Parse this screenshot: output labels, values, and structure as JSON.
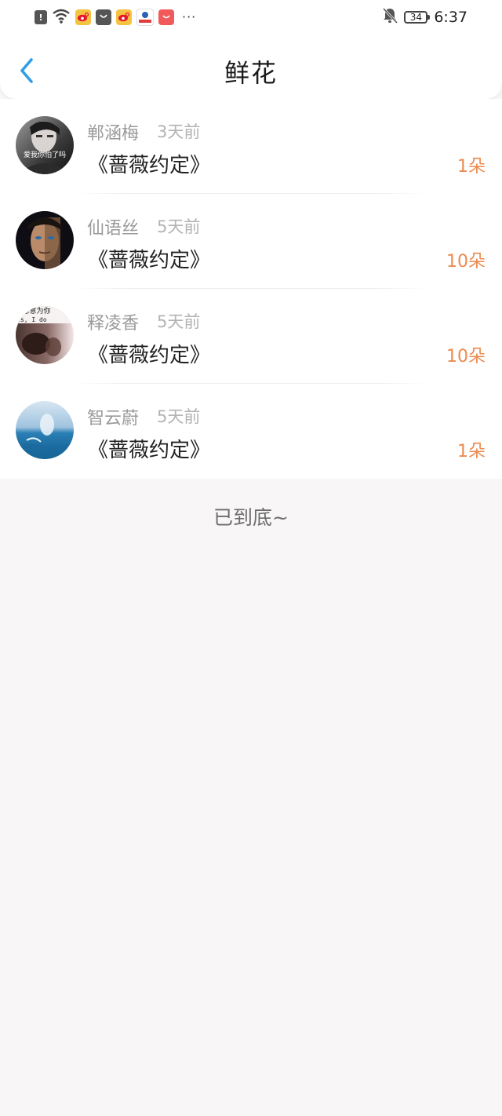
{
  "status_bar": {
    "battery": "34",
    "time": "6:37",
    "more": "···",
    "icons": [
      "alert-icon",
      "wifi-icon",
      "weibo-icon",
      "shopping-bag-icon",
      "weibo-icon",
      "app-icon",
      "app-icon"
    ]
  },
  "header": {
    "title": "鲜花",
    "back_icon": "chevron-left-icon"
  },
  "items": [
    {
      "name": "郸涵梅",
      "time": "3天前",
      "book": "《蔷薇约定》",
      "count": "1朵",
      "avatar_text": "爱我你怕了吗"
    },
    {
      "name": "仙语丝",
      "time": "5天前",
      "book": "《蔷薇约定》",
      "count": "10朵"
    },
    {
      "name": "释凌香",
      "time": "5天前",
      "book": "《蔷薇约定》",
      "count": "10朵",
      "avatar_text": "Yes, I do",
      "avatar_text2": "我愿意为你"
    },
    {
      "name": "智云蔚",
      "time": "5天前",
      "book": "《蔷薇约定》",
      "count": "1朵"
    }
  ],
  "footer": "已到底~",
  "colors": {
    "accent": "#2f9ee6",
    "count": "#ec8a4f",
    "background": "#f8f6f7"
  }
}
